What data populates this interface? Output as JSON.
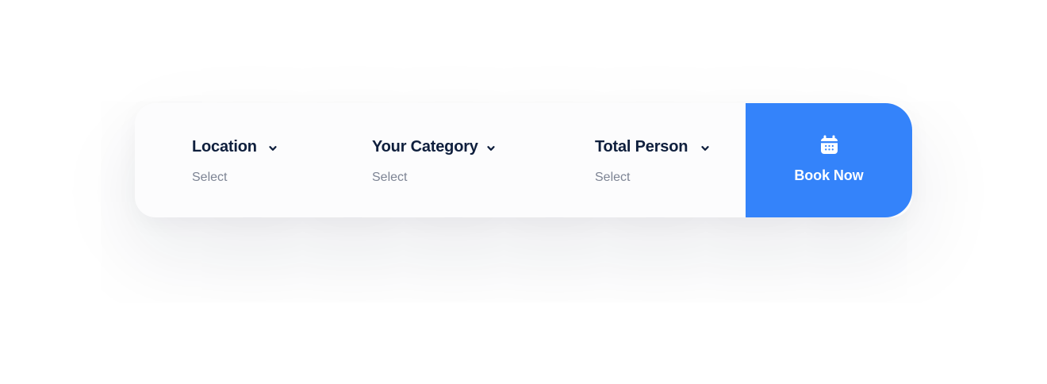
{
  "booking": {
    "fields": [
      {
        "label": "Location",
        "value": "Select",
        "icon": "chevron-down-icon"
      },
      {
        "label": "Your Category",
        "value": "Select",
        "icon": "chevron-down-icon"
      },
      {
        "label": "Total Person",
        "value": "Select",
        "icon": "chevron-down-icon"
      }
    ],
    "button": {
      "label": "Book Now",
      "icon": "calendar-icon"
    }
  },
  "colors": {
    "accent": "#3483fa",
    "title": "#0f1f3d",
    "muted": "#7d8494",
    "panel": "#fcfcfd"
  }
}
